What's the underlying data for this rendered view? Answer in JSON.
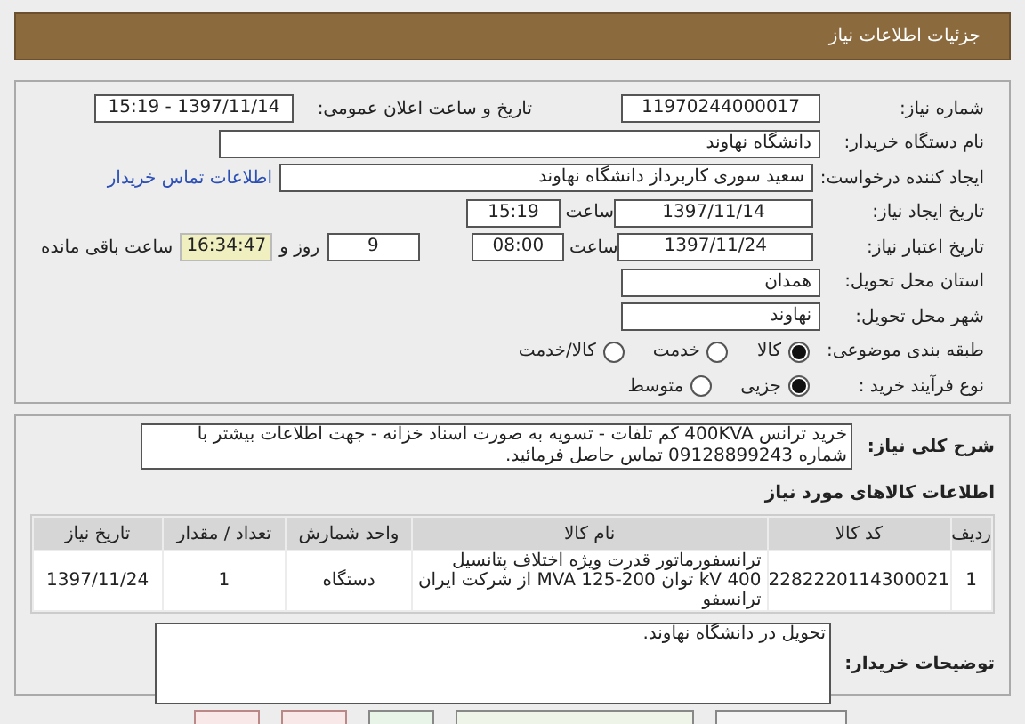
{
  "header": {
    "title": "جزئیات اطلاعات نیاز"
  },
  "need_number": {
    "label": "شماره نیاز:",
    "value": "11970244000017"
  },
  "announce": {
    "label": "تاریخ و ساعت اعلان عمومی:",
    "value": "1397/11/14 - 15:19"
  },
  "buyer_org": {
    "label": "نام دستگاه خریدار:",
    "value": "دانشگاه نهاوند"
  },
  "requester": {
    "label": "ایجاد کننده درخواست:",
    "value": "سعید سوری کاربرداز دانشگاه نهاوند",
    "link": "اطلاعات تماس خریدار"
  },
  "created": {
    "label": "تاریخ ایجاد نیاز:",
    "date": "1397/11/14",
    "time_label": "ساعت",
    "time": "15:19"
  },
  "validity": {
    "label": "تاریخ اعتبار نیاز:",
    "date": "1397/11/24",
    "time_label": "ساعت",
    "time": "08:00",
    "days": "9",
    "days_label": "روز و",
    "remaining": "16:34:47",
    "remaining_label": "ساعت باقی مانده"
  },
  "province": {
    "label": "استان محل تحویل:",
    "value": "همدان"
  },
  "city": {
    "label": "شهر محل تحویل:",
    "value": "نهاوند"
  },
  "category": {
    "label": "طبقه بندی موضوعی:",
    "options": [
      {
        "label": "کالا",
        "selected": true
      },
      {
        "label": "خدمت",
        "selected": false
      },
      {
        "label": "کالا/خدمت",
        "selected": false
      }
    ]
  },
  "process": {
    "label": "نوع فرآیند خرید :",
    "options": [
      {
        "label": "جزیی",
        "selected": true
      },
      {
        "label": "متوسط",
        "selected": false
      }
    ]
  },
  "description": {
    "label": "شرح کلی نیاز:",
    "text": "خرید ترانس 400KVA کم تلفات - تسویه به صورت اسناد خزانه - جهت اطلاعات بیشتر با شماره 09128899243 تماس حاصل فرمائید."
  },
  "goods": {
    "title": "اطلاعات کالاهای مورد نیاز",
    "columns": [
      "ردیف",
      "کد کالا",
      "نام کالا",
      "واحد شمارش",
      "تعداد / مقدار",
      "تاریخ نیاز"
    ],
    "rows": [
      [
        "1",
        "2282220114300021",
        "ترانسفورماتور قدرت ویژه اختلاف پتانسیل 400 kV توان 200-125 MVA از شرکت ایران ترانسفو",
        "دستگاه",
        "1",
        "1397/11/24"
      ]
    ]
  },
  "notes": {
    "label": "توضیحات خریدار:",
    "text": "تحویل در دانشگاه نهاوند."
  }
}
